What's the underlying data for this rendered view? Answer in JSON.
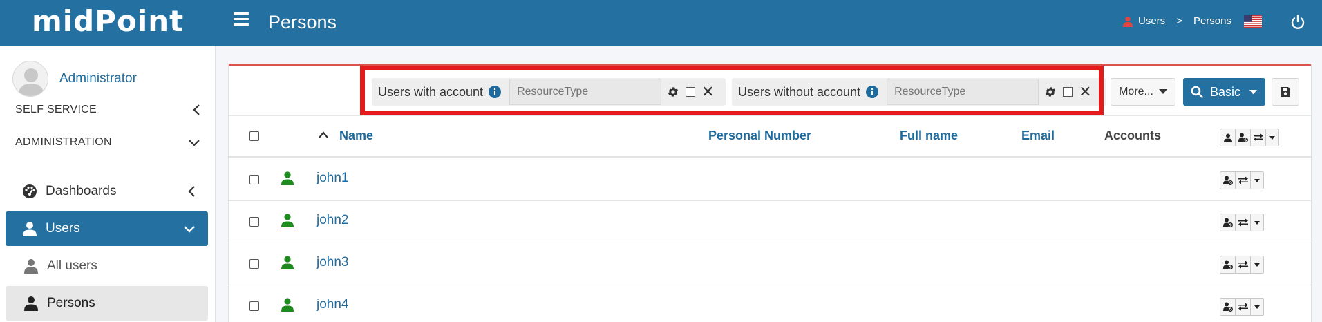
{
  "header": {
    "logo": "midPoint",
    "page_title": "Persons",
    "breadcrumbs": [
      {
        "label": "Users",
        "icon": "user-icon"
      },
      {
        "label": "Persons"
      }
    ],
    "breadcrumb_separator": ">",
    "locale_flag": "us-flag",
    "brand_color": "#2370a1"
  },
  "sidebar": {
    "profile_name": "Administrator",
    "sections": [
      {
        "label": "SELF SERVICE",
        "expanded": false
      },
      {
        "label": "ADMINISTRATION",
        "expanded": true
      }
    ],
    "items": [
      {
        "label": "Dashboards",
        "icon": "dashboard-icon"
      },
      {
        "label": "Users",
        "icon": "user-icon",
        "active": true
      },
      {
        "label": "All users",
        "icon": "user-icon"
      },
      {
        "label": "Persons",
        "icon": "user-icon",
        "selected": true
      }
    ]
  },
  "search": {
    "filters": [
      {
        "label": "Users with account",
        "placeholder": "ResourceType"
      },
      {
        "label": "Users without account",
        "placeholder": "ResourceType"
      }
    ],
    "more_label": "More...",
    "basic_label": "Basic",
    "highlight_color": "#e41b1b"
  },
  "table": {
    "columns": [
      "Name",
      "Personal Number",
      "Full name",
      "Email",
      "Accounts"
    ],
    "sort_column": "Name",
    "sort_direction": "ascending",
    "rows": [
      {
        "name": "john1"
      },
      {
        "name": "john2"
      },
      {
        "name": "john3"
      },
      {
        "name": "john4"
      }
    ],
    "status_color": "#1f8a1f"
  }
}
